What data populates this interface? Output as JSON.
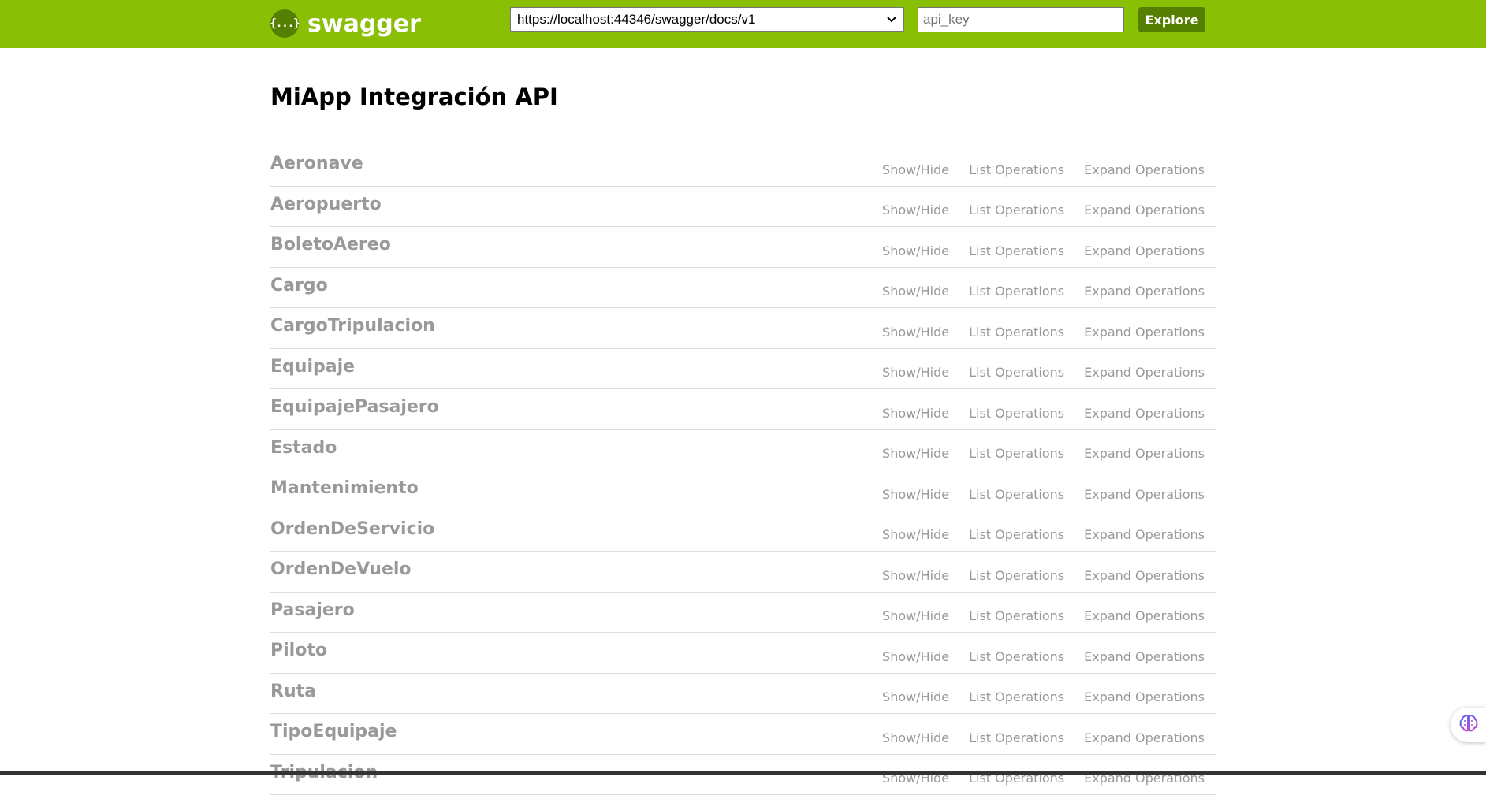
{
  "header": {
    "logo_text": "swagger",
    "logo_icon": "{...}",
    "spec_url": "https://localhost:44346/swagger/docs/v1",
    "api_key_placeholder": "api_key",
    "explore_label": "Explore",
    "background_color": "#89bf04",
    "accent_color": "#547f00"
  },
  "main": {
    "title": "MiApp Integración API"
  },
  "resources": [
    {
      "name": "Aeronave",
      "ops": [
        "Show/Hide",
        "List Operations",
        "Expand Operations"
      ]
    },
    {
      "name": "Aeropuerto",
      "ops": [
        "Show/Hide",
        "List Operations",
        "Expand Operations"
      ]
    },
    {
      "name": "BoletoAereo",
      "ops": [
        "Show/Hide",
        "List Operations",
        "Expand Operations"
      ]
    },
    {
      "name": "Cargo",
      "ops": [
        "Show/Hide",
        "List Operations",
        "Expand Operations"
      ]
    },
    {
      "name": "CargoTripulacion",
      "ops": [
        "Show/Hide",
        "List Operations",
        "Expand Operations"
      ]
    },
    {
      "name": "Equipaje",
      "ops": [
        "Show/Hide",
        "List Operations",
        "Expand Operations"
      ]
    },
    {
      "name": "EquipajePasajero",
      "ops": [
        "Show/Hide",
        "List Operations",
        "Expand Operations"
      ]
    },
    {
      "name": "Estado",
      "ops": [
        "Show/Hide",
        "List Operations",
        "Expand Operations"
      ]
    },
    {
      "name": "Mantenimiento",
      "ops": [
        "Show/Hide",
        "List Operations",
        "Expand Operations"
      ]
    },
    {
      "name": "OrdenDeServicio",
      "ops": [
        "Show/Hide",
        "List Operations",
        "Expand Operations"
      ]
    },
    {
      "name": "OrdenDeVuelo",
      "ops": [
        "Show/Hide",
        "List Operations",
        "Expand Operations"
      ]
    },
    {
      "name": "Pasajero",
      "ops": [
        "Show/Hide",
        "List Operations",
        "Expand Operations"
      ]
    },
    {
      "name": "Piloto",
      "ops": [
        "Show/Hide",
        "List Operations",
        "Expand Operations"
      ]
    },
    {
      "name": "Ruta",
      "ops": [
        "Show/Hide",
        "List Operations",
        "Expand Operations"
      ]
    },
    {
      "name": "TipoEquipaje",
      "ops": [
        "Show/Hide",
        "List Operations",
        "Expand Operations"
      ]
    },
    {
      "name": "Tripulacion",
      "ops": [
        "Show/Hide",
        "List Operations",
        "Expand Operations"
      ]
    }
  ],
  "floating_button": {
    "icon": "brain-icon"
  }
}
